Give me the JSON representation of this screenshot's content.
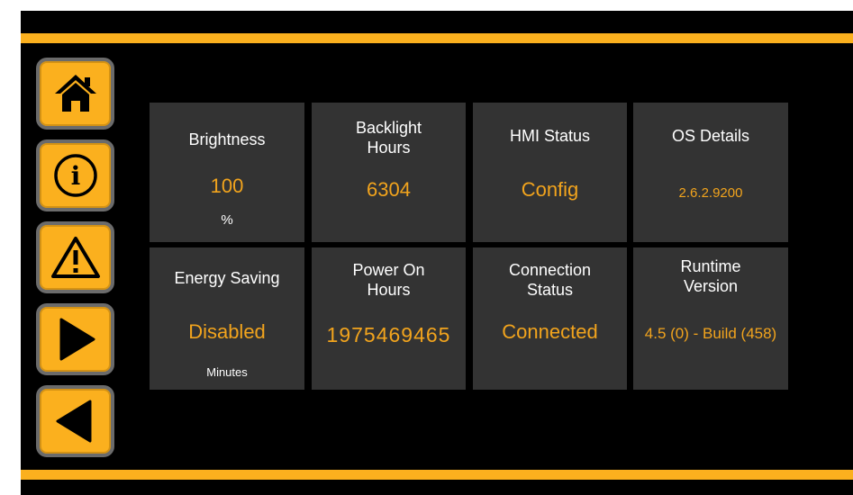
{
  "nav": {
    "items": [
      {
        "icon": "home-icon"
      },
      {
        "icon": "info-icon"
      },
      {
        "icon": "warning-icon"
      },
      {
        "icon": "play-right-icon"
      },
      {
        "icon": "back-left-icon"
      }
    ]
  },
  "colors": {
    "accent": "#fbb01e",
    "value_text": "#f2a41d",
    "tile_bg": "#333333",
    "screen_bg": "#000000"
  },
  "tiles": {
    "brightness": {
      "label": "Brightness",
      "value": "100",
      "unit": "%"
    },
    "backlight_hours": {
      "label": "Backlight\nHours",
      "value": "6304"
    },
    "hmi_status": {
      "label": "HMI Status",
      "value": "Config"
    },
    "os_details": {
      "label": "OS Details",
      "value": "2.6.2.9200"
    },
    "energy_saving": {
      "label": "Energy Saving",
      "value": "Disabled",
      "unit": "Minutes"
    },
    "power_on_hours": {
      "label": "Power On\nHours",
      "value": "1975469465"
    },
    "connection_status": {
      "label": "Connection\nStatus",
      "value": "Connected"
    },
    "runtime_version": {
      "label": "Runtime\nVersion",
      "value": "4.5 (0) - Build (458)"
    }
  }
}
